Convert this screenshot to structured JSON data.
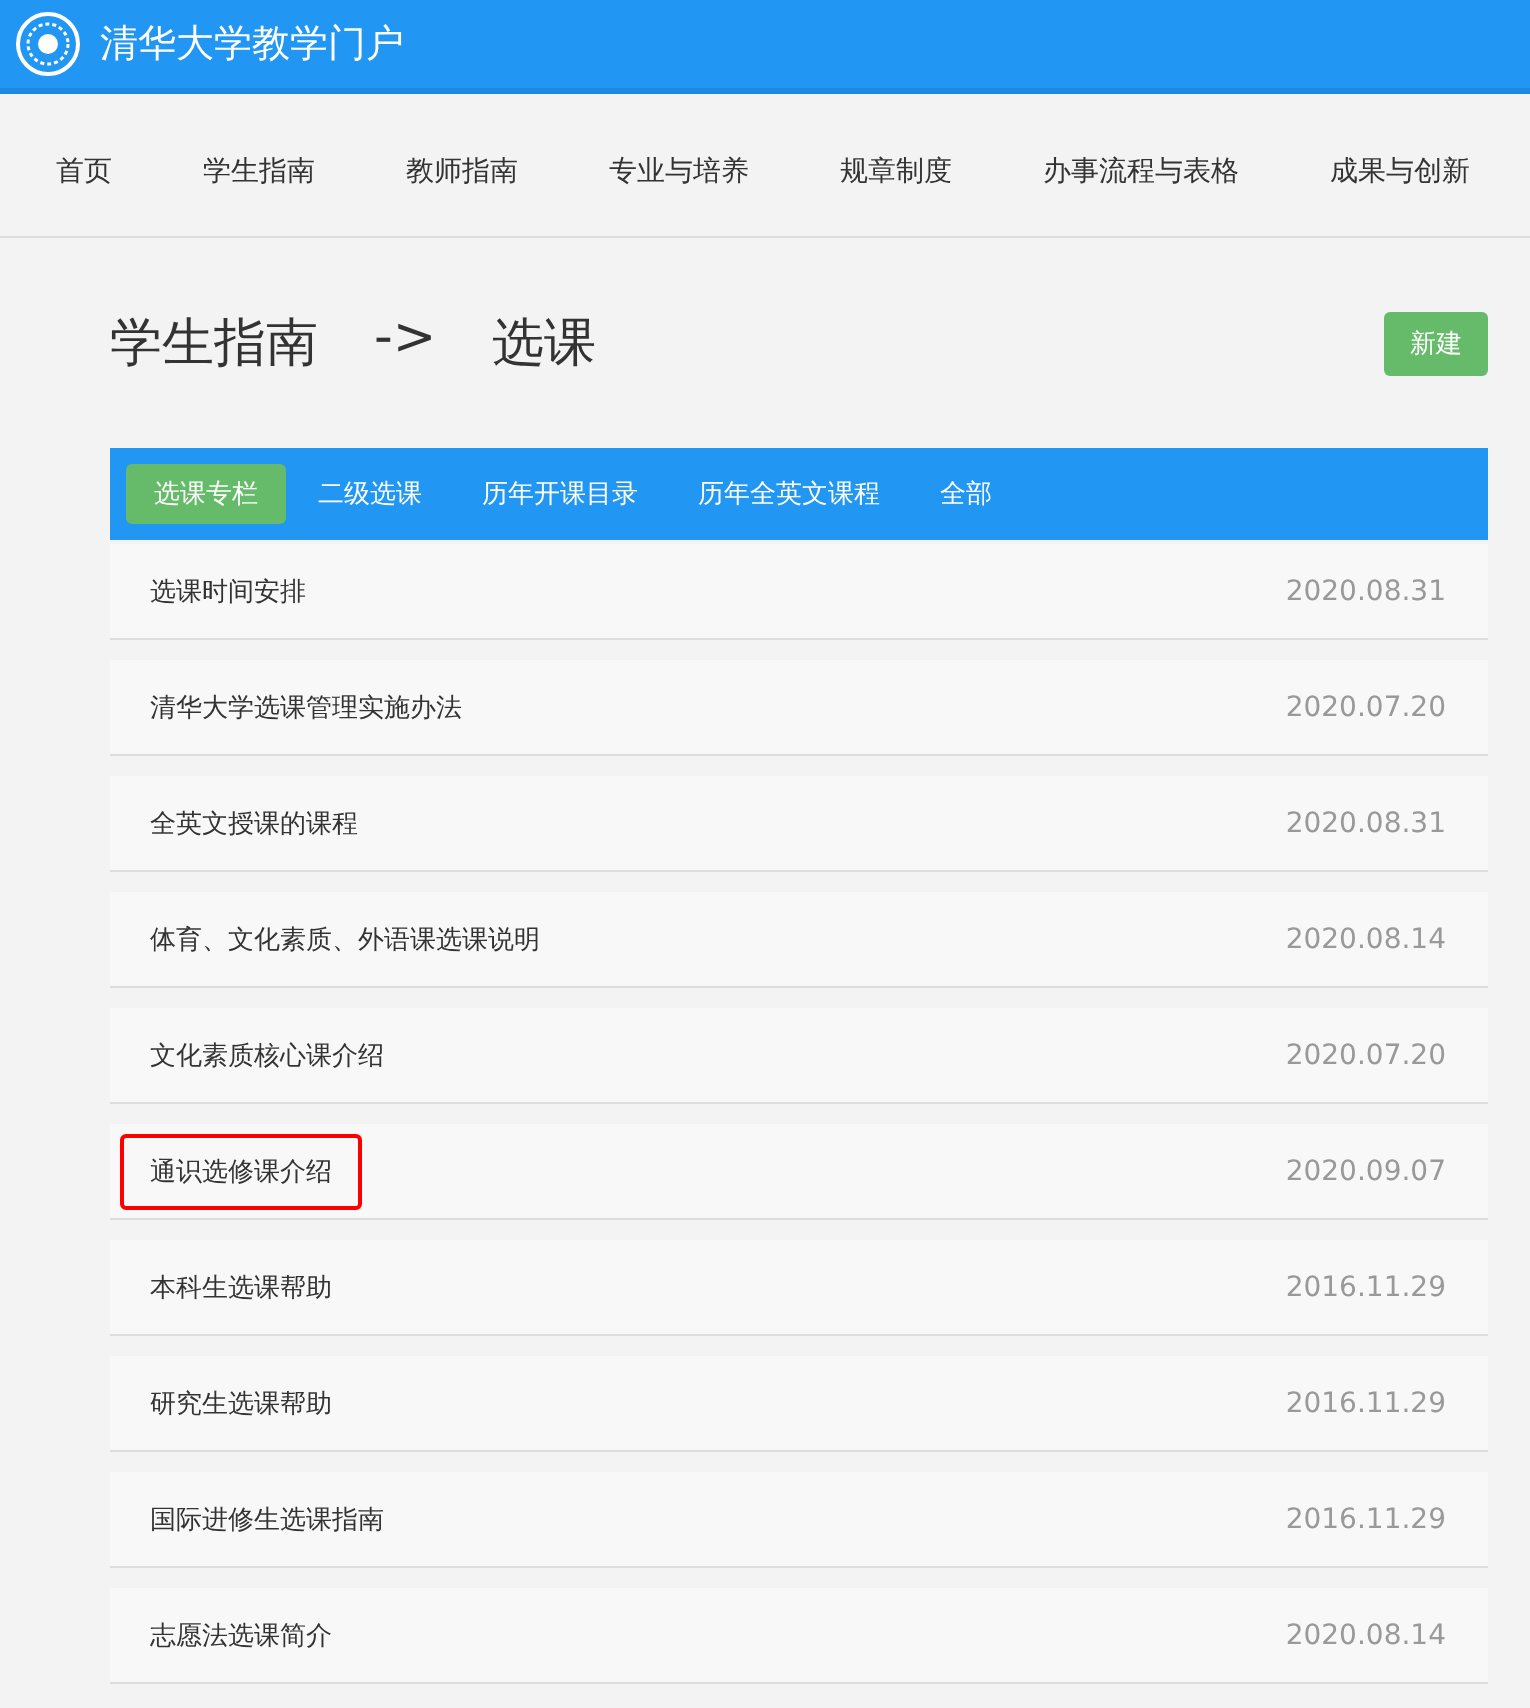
{
  "header": {
    "title": "清华大学教学门户"
  },
  "nav": [
    "首页",
    "学生指南",
    "教师指南",
    "专业与培养",
    "规章制度",
    "办事流程与表格",
    "成果与创新"
  ],
  "page_title": {
    "section": "学生指南",
    "arrow": "->",
    "current": "选课"
  },
  "new_button": "新建",
  "tabs": [
    {
      "label": "选课专栏",
      "selected": true
    },
    {
      "label": "二级选课",
      "selected": false
    },
    {
      "label": "历年开课目录",
      "selected": false
    },
    {
      "label": "历年全英文课程",
      "selected": false
    },
    {
      "label": "全部",
      "selected": false
    }
  ],
  "items": [
    {
      "title": "选课时间安排",
      "date": "2020.08.31",
      "highlighted": false
    },
    {
      "title": "清华大学选课管理实施办法",
      "date": "2020.07.20",
      "highlighted": false
    },
    {
      "title": "全英文授课的课程",
      "date": "2020.08.31",
      "highlighted": false
    },
    {
      "title": "体育、文化素质、外语课选课说明",
      "date": "2020.08.14",
      "highlighted": false
    },
    {
      "title": "文化素质核心课介绍",
      "date": "2020.07.20",
      "highlighted": false
    },
    {
      "title": "通识选修课介绍",
      "date": "2020.09.07",
      "highlighted": true
    },
    {
      "title": "本科生选课帮助",
      "date": "2016.11.29",
      "highlighted": false
    },
    {
      "title": "研究生选课帮助",
      "date": "2016.11.29",
      "highlighted": false
    },
    {
      "title": "国际进修生选课指南",
      "date": "2016.11.29",
      "highlighted": false
    },
    {
      "title": "志愿法选课简介",
      "date": "2020.08.14",
      "highlighted": false
    }
  ]
}
